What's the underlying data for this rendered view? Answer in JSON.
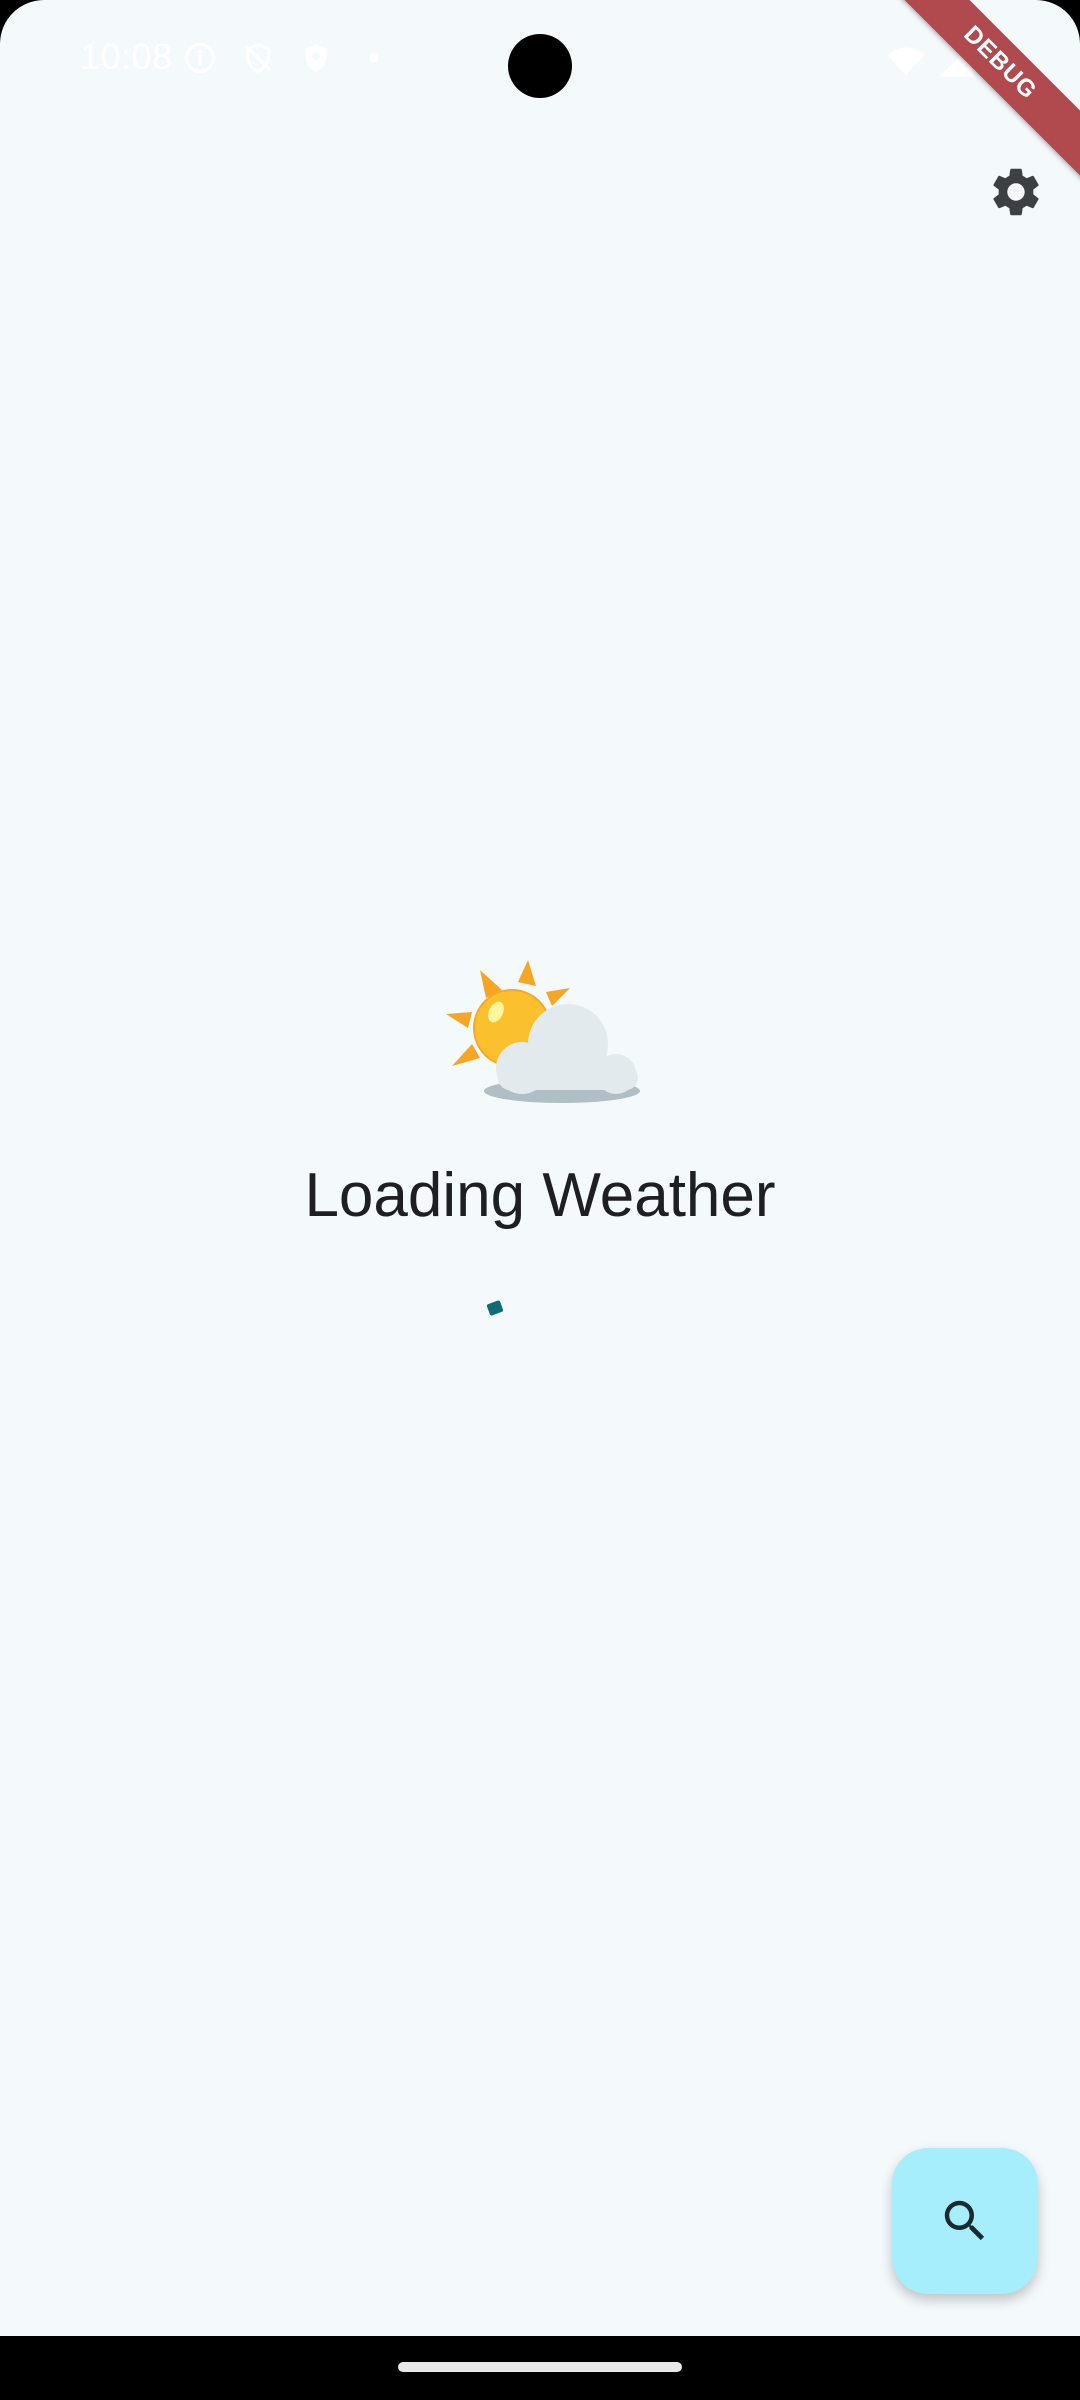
{
  "status_bar": {
    "time": "10:08"
  },
  "debug_ribbon": {
    "label": "DEBUG"
  },
  "icons": {
    "settings": "gear-icon",
    "search": "search-icon",
    "weather": "sun-behind-cloud-icon"
  },
  "main": {
    "loading_text": "Loading Weather"
  },
  "colors": {
    "background": "#f4f9fb",
    "fab": "#a6eefb",
    "spinner": "#0f6b76",
    "ribbon": "#b04a4f"
  }
}
